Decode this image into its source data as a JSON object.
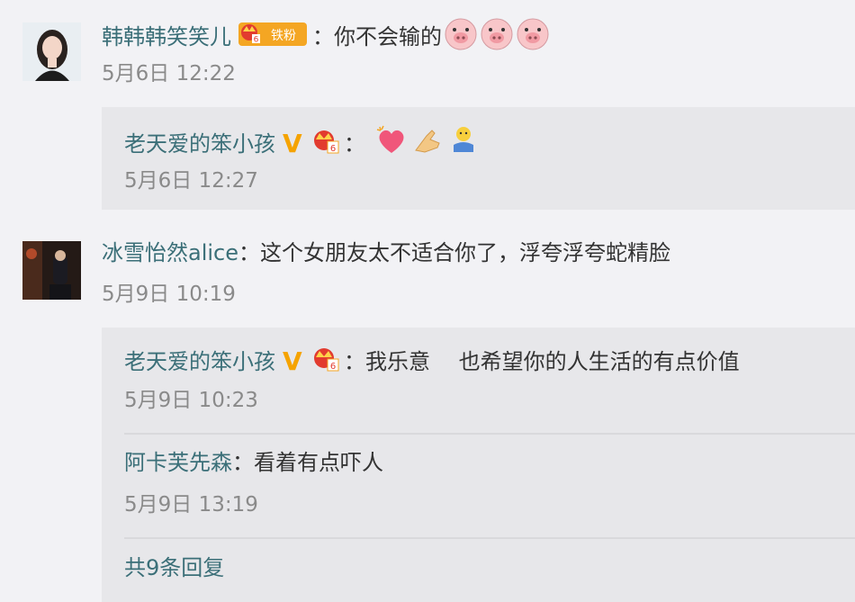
{
  "comments": [
    {
      "user": "韩韩韩笑笑儿",
      "fan_badge": "铁粉",
      "badge_level": "6",
      "colon": "：",
      "text": "你不会输的",
      "time": "5月6日 12:22",
      "emoji": [
        "pig-face",
        "pig-face",
        "pig-face"
      ]
    },
    {
      "user": "冰雪怡然alice",
      "colon": "：",
      "text": "这个女朋友太不适合你了，浮夸浮夸蛇精脸",
      "time": "5月9日 10:19"
    }
  ],
  "replies": [
    {
      "user": "老天爱的笨小孩",
      "badge_level": "6",
      "colon": "：",
      "time": "5月6日 12:27",
      "emoji": [
        "sparkling-heart",
        "pinching-hand",
        "hugging-person"
      ]
    },
    {
      "user": "老天爱的笨小孩",
      "badge_level": "6",
      "colon": "：",
      "text": "我乐意　 也希望你的人生活的有点价值",
      "time": "5月9日 10:23"
    },
    {
      "user": "阿卡芙先森",
      "colon": "：",
      "text": "看着有点吓人",
      "time": "5月9日 13:19"
    }
  ],
  "more_replies": "共9条回复",
  "colors": {
    "background": "#f2f2f5",
    "reply_background": "#e7e7ea",
    "username": "#3b6f78",
    "time": "#8a8a8a",
    "vip_gold": "#f5a300"
  }
}
